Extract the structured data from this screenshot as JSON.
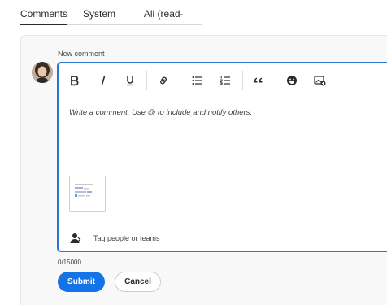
{
  "tabs": [
    {
      "label": "Comments"
    },
    {
      "label": "System activity"
    },
    {
      "label": "All (read-only)"
    }
  ],
  "composer": {
    "label": "New comment",
    "placeholder": "Write a comment. Use @ to include and notify others.",
    "tag_label": "Tag people or teams",
    "counter": "0/15000",
    "submit_label": "Submit",
    "cancel_label": "Cancel"
  },
  "toolbar": {
    "bold_icon": "bold-icon",
    "italic_icon": "italic-icon",
    "underline_icon": "underline-icon",
    "link_icon": "link-icon",
    "bullet_list_icon": "bullet-list-icon",
    "numbered_list_icon": "numbered-list-icon",
    "quote_icon": "quote-icon",
    "emoji_icon": "emoji-icon",
    "image_icon": "add-image-icon"
  },
  "colors": {
    "accent": "#1473e6",
    "focus_border": "#2b77d0",
    "text": "#2c2c2c"
  }
}
